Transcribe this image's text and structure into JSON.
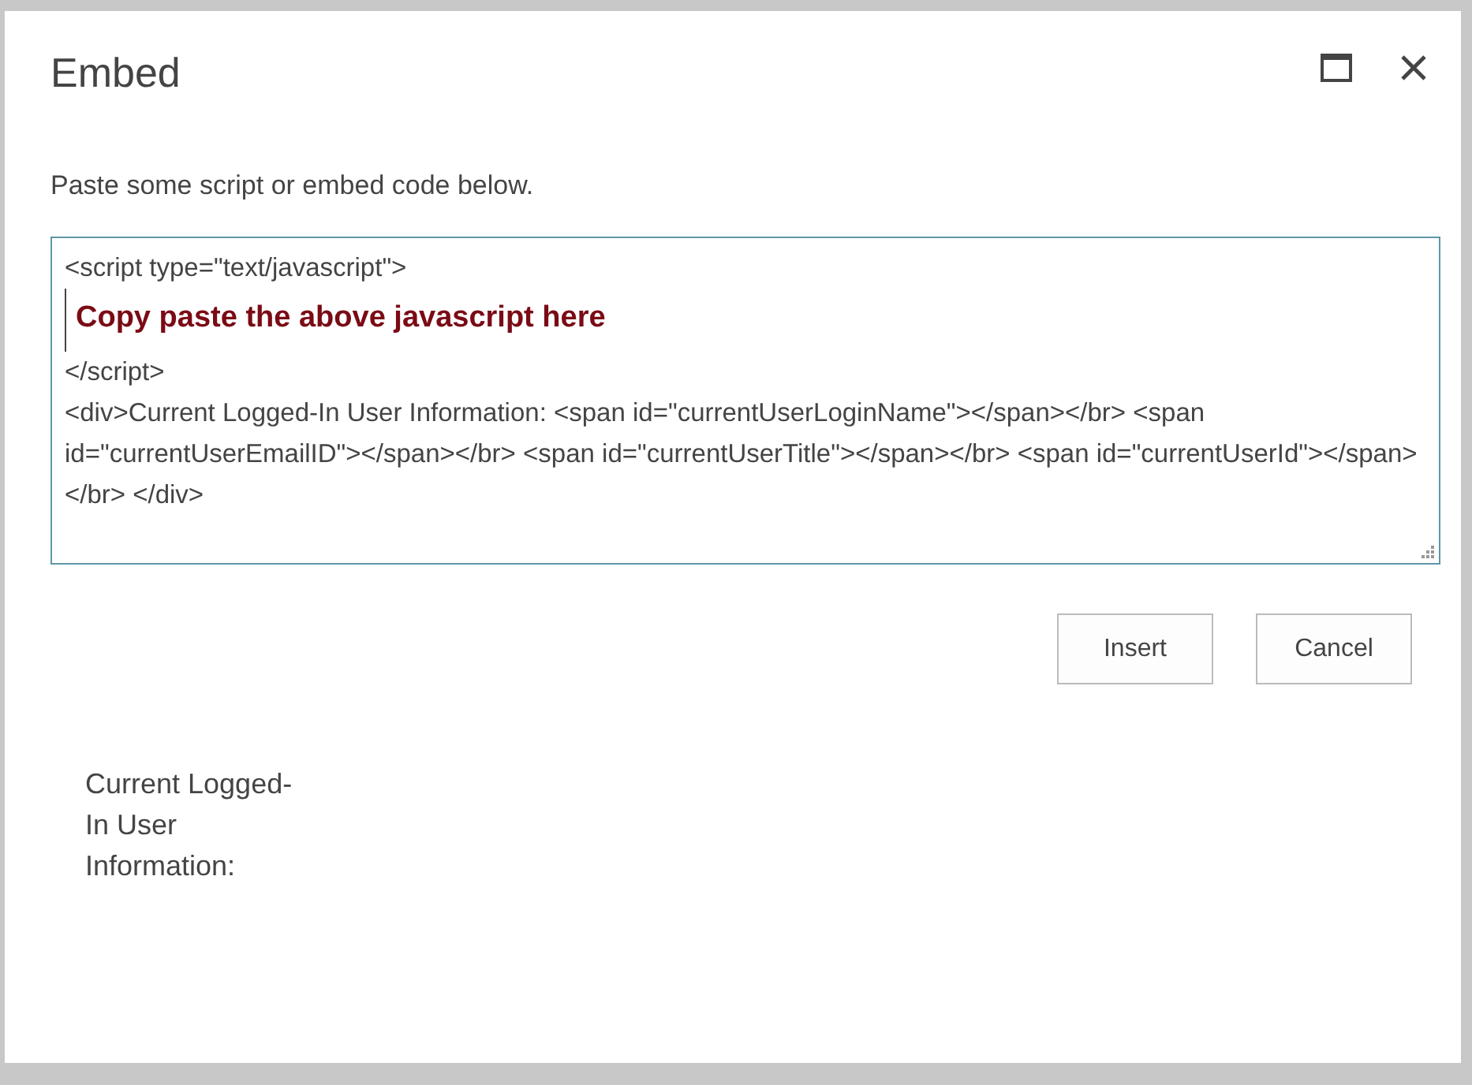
{
  "dialog": {
    "title": "Embed",
    "instruction": "Paste some script or embed code below.",
    "code_lines": [
      {
        "kind": "code",
        "text": "<script type=\"text/javascript\">"
      },
      {
        "kind": "note",
        "text": "Copy paste the above javascript here"
      },
      {
        "kind": "code",
        "text": "</script>"
      },
      {
        "kind": "code",
        "text": "<div>Current Logged-In User Information: <span id=\"currentUserLoginName\"></span></br> <span id=\"currentUserEmailID\"></span></br> <span id=\"currentUserTitle\"></span></br> <span id=\"currentUserId\"></span></br> </div>"
      }
    ],
    "buttons": [
      "Insert",
      "Cancel"
    ],
    "preview": "Current Logged-In User Information:"
  }
}
